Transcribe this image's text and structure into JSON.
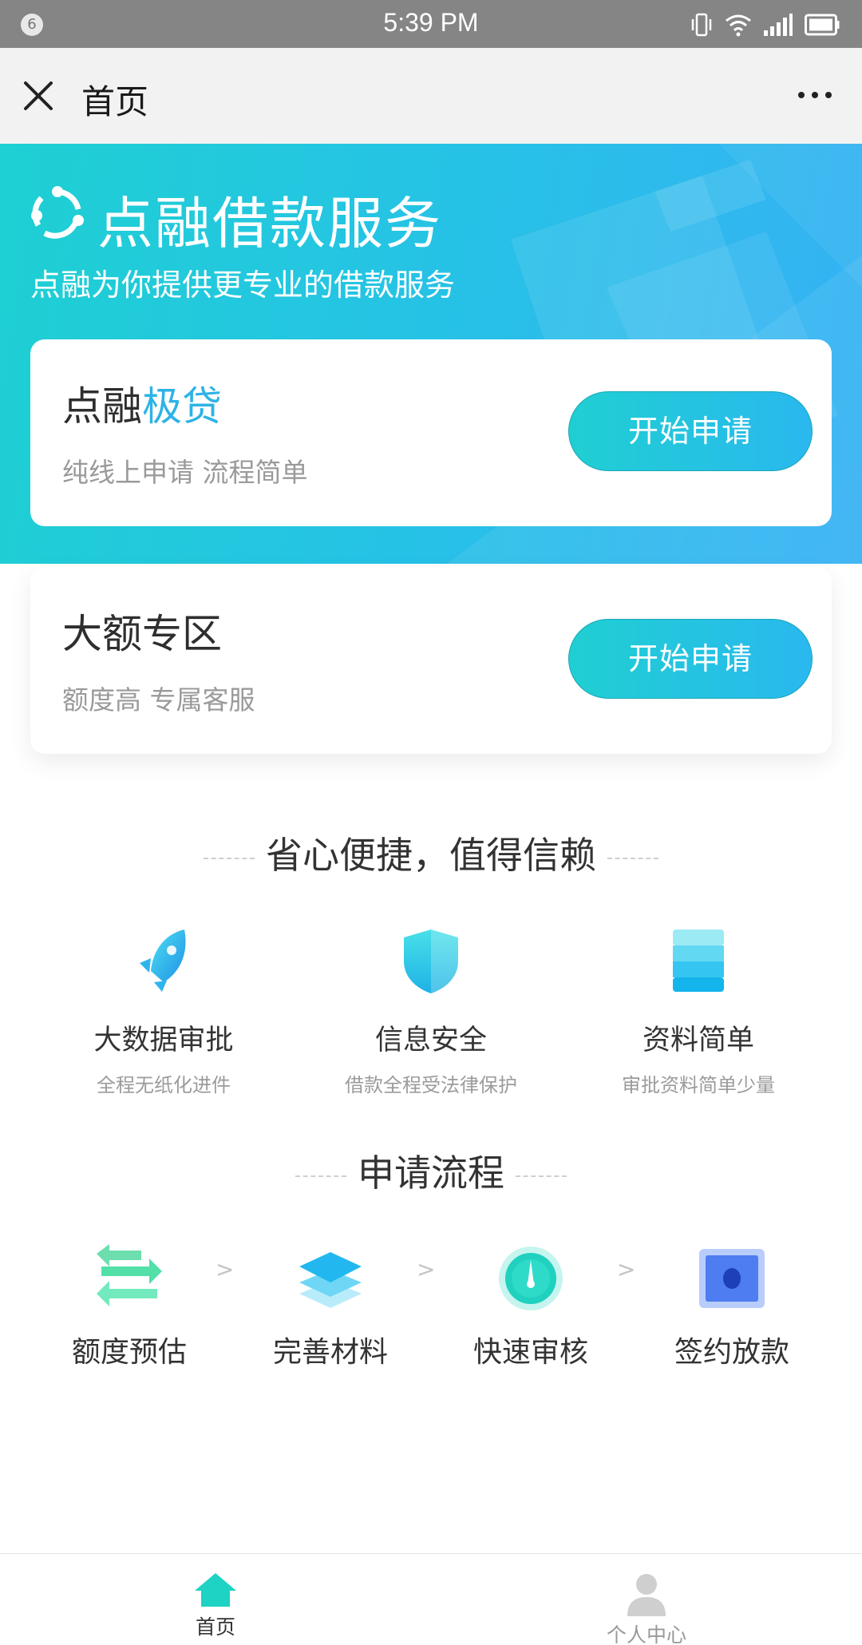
{
  "status_bar": {
    "notification_count": "6",
    "time": "5:39 PM",
    "icons": [
      "vibrate-icon",
      "wifi-icon",
      "signal-icon",
      "battery-icon"
    ]
  },
  "title_bar": {
    "title": "首页",
    "close_icon": "close-icon",
    "more_icon": "more-icon"
  },
  "hero": {
    "title": "点融借款服务",
    "subtitle": "点融为你提供更专业的借款服务",
    "logo_icon": "dianrong-logo"
  },
  "cards": [
    {
      "title_prefix": "点融",
      "title_accent": "极贷",
      "subtitle": "纯线上申请 流程简单",
      "button": "开始申请"
    },
    {
      "title_prefix": "大额专区",
      "title_accent": "",
      "subtitle": "额度高 专属客服",
      "button": "开始申请"
    }
  ],
  "features_section": {
    "title": "省心便捷，值得信赖",
    "items": [
      {
        "name": "大数据审批",
        "desc": "全程无纸化进件",
        "icon": "rocket-icon"
      },
      {
        "name": "信息安全",
        "desc": "借款全程受法律保护",
        "icon": "shield-icon"
      },
      {
        "name": "资料简单",
        "desc": "审批资料简单少量",
        "icon": "document-stack-icon"
      }
    ]
  },
  "process_section": {
    "title": "申请流程",
    "separator": ">",
    "steps": [
      {
        "name": "额度预估",
        "icon": "exchange-arrows-icon"
      },
      {
        "name": "完善材料",
        "icon": "layers-icon"
      },
      {
        "name": "快速审核",
        "icon": "gauge-icon"
      },
      {
        "name": "签约放款",
        "icon": "card-icon"
      }
    ]
  },
  "tab_bar": {
    "items": [
      {
        "label": "首页",
        "icon": "home-icon",
        "active": true
      },
      {
        "label": "个人中心",
        "icon": "user-icon",
        "active": false
      }
    ]
  },
  "colors": {
    "accent": "#2db3e6",
    "hero_start": "#1ed0d2",
    "hero_end": "#36b1f4",
    "active_tab": "#1ed2c4"
  }
}
